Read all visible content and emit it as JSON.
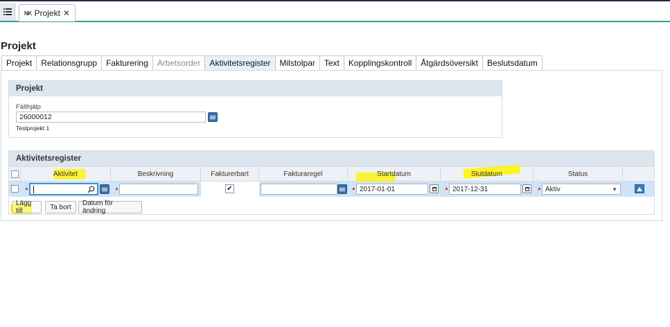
{
  "window": {
    "tab_prefix": "NK",
    "tab_title": "Projekt",
    "tab_close": "✕"
  },
  "page": {
    "title": "Projekt"
  },
  "subtabs": [
    {
      "label": "Projekt",
      "state": "normal"
    },
    {
      "label": "Relationsgrupp",
      "state": "normal"
    },
    {
      "label": "Fakturering",
      "state": "normal"
    },
    {
      "label": "Arbetsorder",
      "state": "disabled"
    },
    {
      "label": "Aktivitetsregister",
      "state": "active"
    },
    {
      "label": "Milstolpar",
      "state": "normal"
    },
    {
      "label": "Text",
      "state": "normal"
    },
    {
      "label": "Kopplingskontroll",
      "state": "normal"
    },
    {
      "label": "Åtgärdsöversikt",
      "state": "normal"
    },
    {
      "label": "Beslutsdatum",
      "state": "normal"
    }
  ],
  "project_panel": {
    "title": "Projekt",
    "field_label": "Fälthjälp",
    "field_value": "26000012",
    "description": "Testprojekt 1"
  },
  "activity_panel": {
    "title": "Aktivitetsregister",
    "columns": {
      "aktivitet": "Aktivitet",
      "beskrivning": "Beskrivning",
      "fakturerbart": "Fakturerbart",
      "fakturaregel": "Fakturaregel",
      "startdatum": "Startdatum",
      "slutdatum": "Slutdatum",
      "status": "Status"
    },
    "row": {
      "aktivitet": "",
      "beskrivning": "",
      "fakturerbart": true,
      "fakturaregel": "",
      "startdatum": "2017-01-01",
      "slutdatum": "2017-12-31",
      "status": "Aktiv"
    },
    "buttons": {
      "add": "Lägg till",
      "remove": "Ta bort",
      "change_date": "Datum för ändring"
    }
  },
  "colors": {
    "accent_line": "#3a9b8f",
    "highlight": "#fff500",
    "row_selected": "#cfe4f6"
  }
}
